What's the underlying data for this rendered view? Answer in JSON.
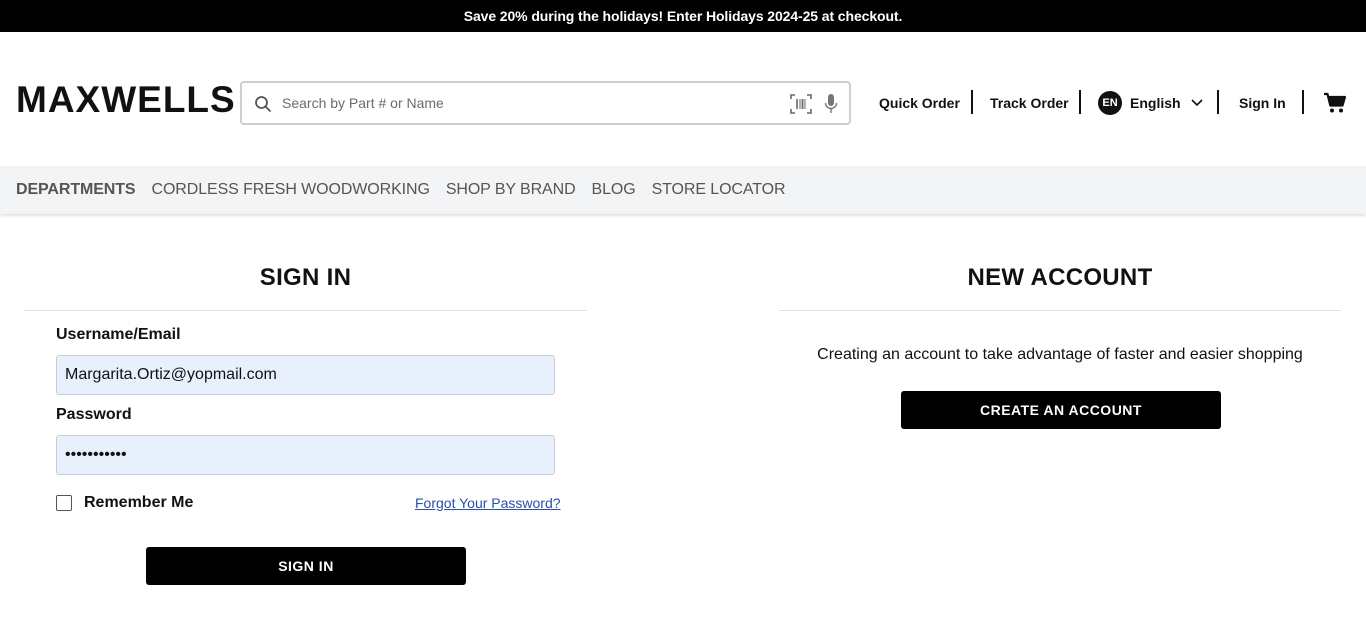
{
  "promo": {
    "text": "Save 20% during the holidays! Enter Holidays 2024-25 at checkout."
  },
  "header": {
    "logo": "MAXWELLS",
    "search": {
      "placeholder": "Search by Part # or Name",
      "value": ""
    },
    "quick_order": "Quick Order",
    "track_order": "Track Order",
    "language": {
      "code": "EN",
      "label": "English"
    },
    "sign_in": "Sign In"
  },
  "nav": {
    "items": [
      "DEPARTMENTS",
      "CORDLESS FRESH WOODWORKING",
      "SHOP BY BRAND",
      "BLOG",
      "STORE LOCATOR"
    ]
  },
  "signin": {
    "title": "SIGN IN",
    "username_label": "Username/Email",
    "username_value": "Margarita.Ortiz@yopmail.com",
    "password_label": "Password",
    "password_value": "•••••••••••",
    "remember_label": "Remember Me",
    "remember_checked": false,
    "forgot_link": "Forgot Your Password?",
    "button": "SIGN IN"
  },
  "new_account": {
    "title": "NEW ACCOUNT",
    "description": "Creating an account to take advantage of faster and easier shopping",
    "button": "CREATE AN ACCOUNT"
  },
  "colors": {
    "black": "#000000",
    "nav_bg": "#f3f4f5",
    "input_bg": "#e8f0fe",
    "link": "#2a4fa8"
  }
}
